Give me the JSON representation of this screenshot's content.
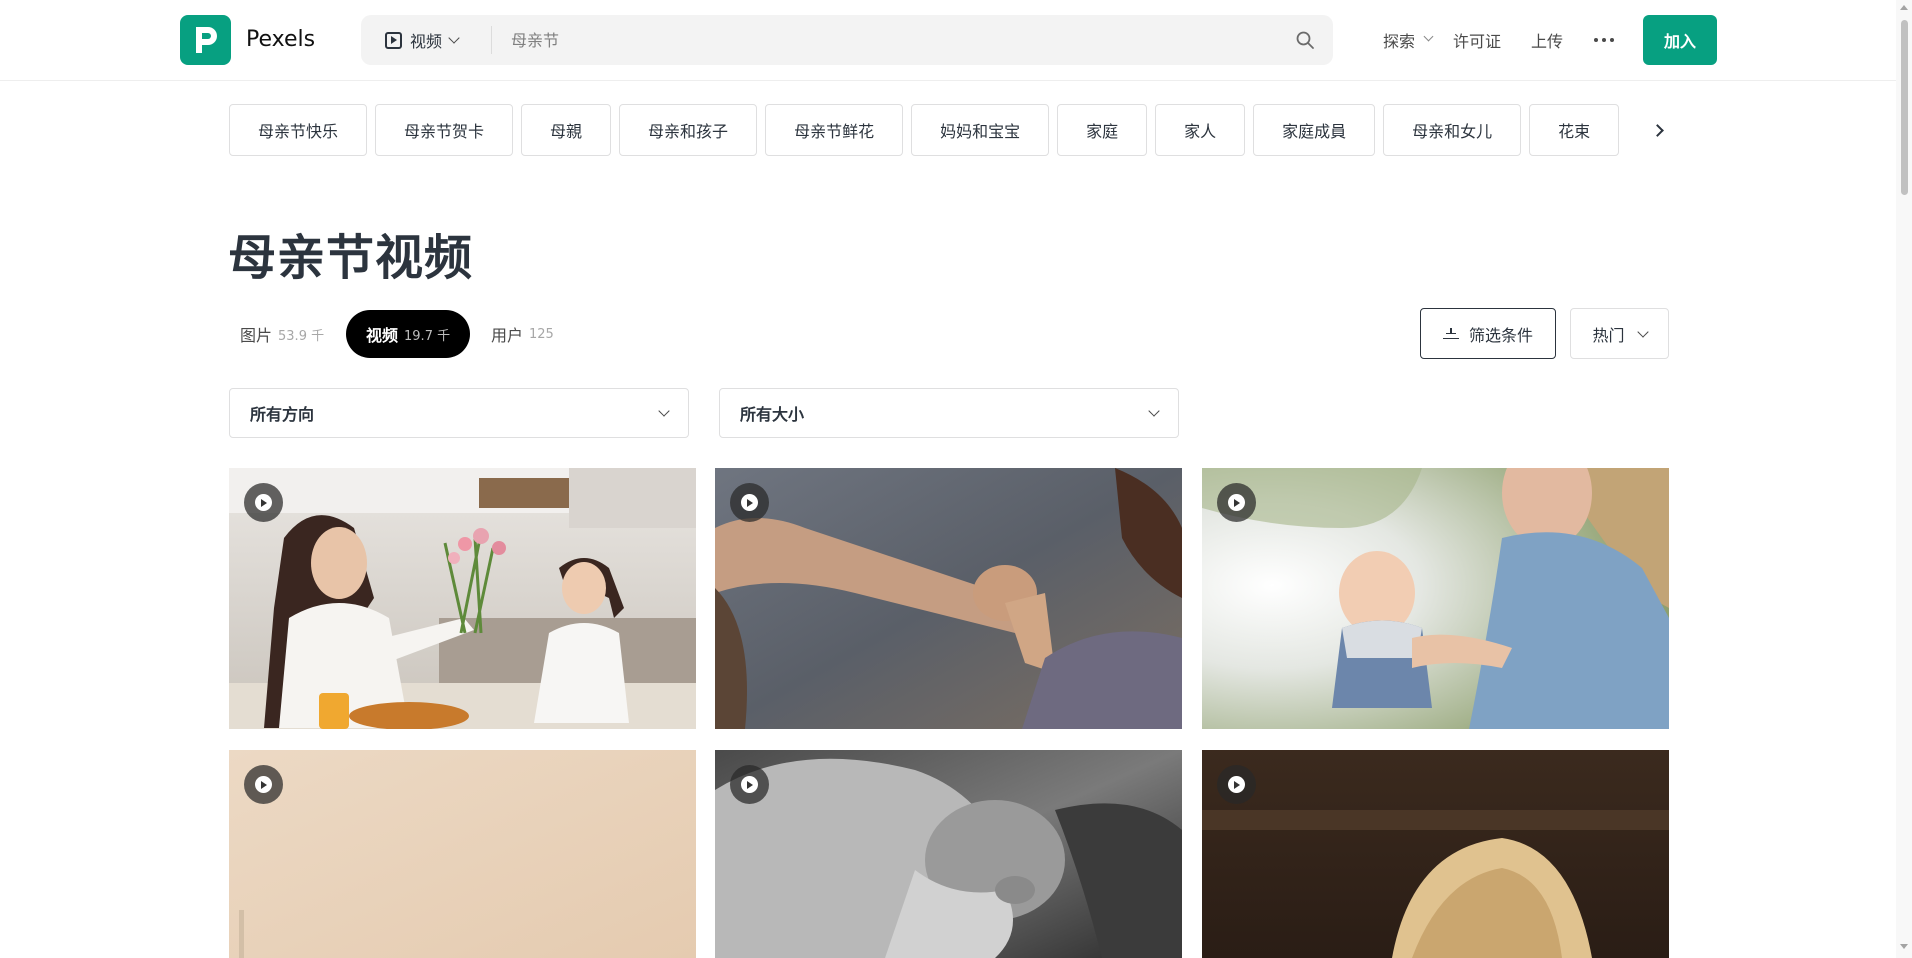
{
  "header": {
    "brand": "Pexels",
    "search_type": "视频",
    "search_placeholder": "母亲节",
    "nav": {
      "explore": "探索",
      "license": "许可证",
      "upload": "上传"
    },
    "join": "加入",
    "brand_color": "#07a081"
  },
  "related_searches": [
    "母亲节快乐",
    "母亲节贺卡",
    "母親",
    "母亲和孩子",
    "母亲节鲜花",
    "妈妈和宝宝",
    "家庭",
    "家人",
    "家庭成員",
    "母亲和女儿",
    "花束"
  ],
  "page_title": "母亲节视频",
  "tabs": [
    {
      "label": "图片",
      "count": "53.9 千",
      "active": false
    },
    {
      "label": "视频",
      "count": "19.7 千",
      "active": true
    },
    {
      "label": "用户",
      "count": "125",
      "active": false
    }
  ],
  "filter_label": "筛选条件",
  "sort_label": "热门",
  "dropdowns": {
    "orientation": "所有方向",
    "size": "所有大小"
  },
  "icons": [
    "logo-icon",
    "play-square-icon",
    "chevron-down-icon",
    "search-icon",
    "more-icon",
    "chevron-right-icon",
    "filter-icon",
    "play-icon"
  ]
}
